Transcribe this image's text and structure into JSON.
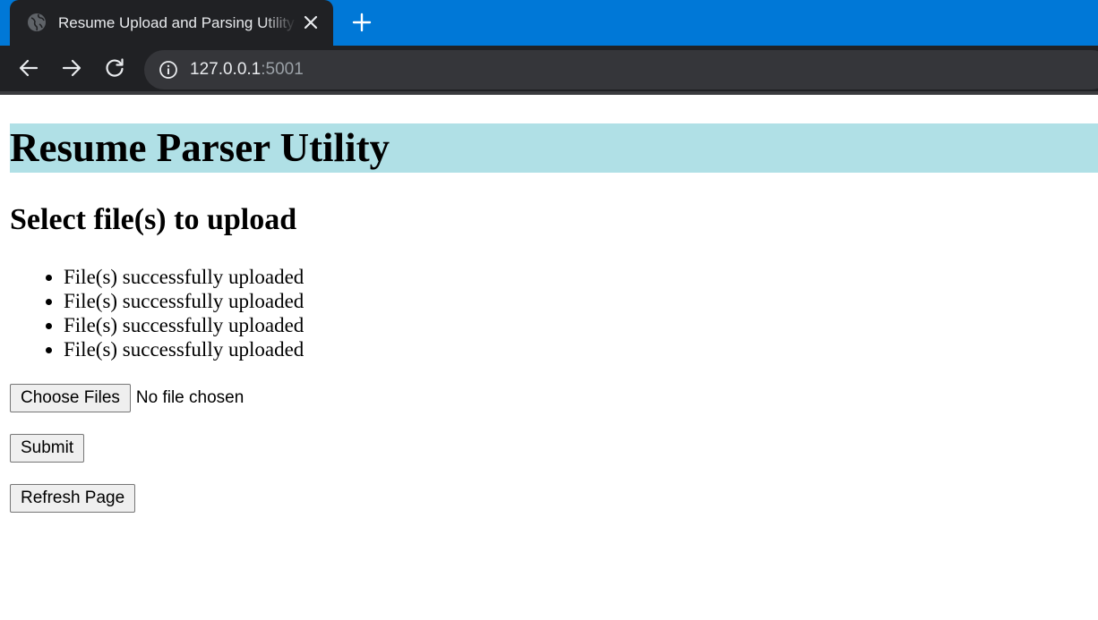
{
  "browser": {
    "tab_title": "Resume Upload and Parsing Utility",
    "url_host": "127.0.0.1",
    "url_port": ":5001"
  },
  "colors": {
    "tabstrip": "#0078d7",
    "chrome": "#202124",
    "omnibox": "#35363a",
    "title_background": "#b0e0e6"
  },
  "icons": {
    "favicon": "globe-icon",
    "tab_close": "close-icon",
    "new_tab": "plus-icon",
    "back": "arrow-left-icon",
    "forward": "arrow-right-icon",
    "reload": "reload-icon",
    "site_info": "info-icon"
  },
  "page": {
    "title": "Resume Parser Utility",
    "subtitle": "Select file(s) to upload",
    "messages": [
      "File(s) successfully uploaded",
      "File(s) successfully uploaded",
      "File(s) successfully uploaded",
      "File(s) successfully uploaded"
    ],
    "choose_files_label": "Choose Files",
    "no_file_text": "No file chosen",
    "submit_label": "Submit",
    "refresh_label": "Refresh Page"
  }
}
